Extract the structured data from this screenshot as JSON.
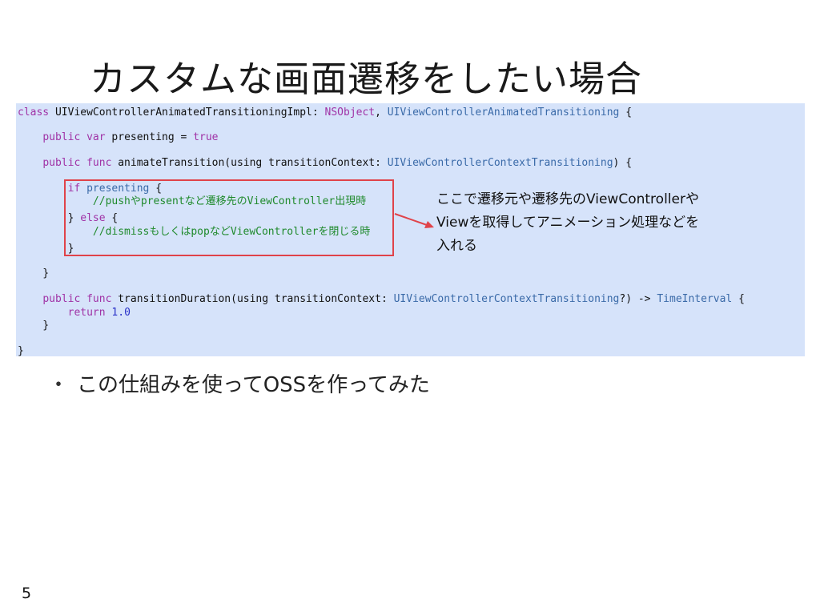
{
  "slide": {
    "title": "カスタムな画面遷移をしたい場合",
    "page_number": "5"
  },
  "code": {
    "line1": [
      {
        "t": "class",
        "c": "kw"
      },
      {
        "t": " UIViewControllerAnimatedTransitioningImpl: ",
        "c": ""
      },
      {
        "t": "NSObject",
        "c": "kw"
      },
      {
        "t": ", ",
        "c": ""
      },
      {
        "t": "UIViewControllerAnimatedTransitioning",
        "c": "ty"
      },
      {
        "t": " {",
        "c": ""
      }
    ],
    "line2": [
      {
        "t": "    ",
        "c": ""
      },
      {
        "t": "public var",
        "c": "kw"
      },
      {
        "t": " presenting = ",
        "c": ""
      },
      {
        "t": "true",
        "c": "kw"
      }
    ],
    "line3": [
      {
        "t": "    ",
        "c": ""
      },
      {
        "t": "public func",
        "c": "kw"
      },
      {
        "t": " animateTransition(using transitionContext: ",
        "c": ""
      },
      {
        "t": "UIViewControllerContextTransitioning",
        "c": "ty"
      },
      {
        "t": ") {",
        "c": ""
      }
    ],
    "line4": [
      {
        "t": "        ",
        "c": ""
      },
      {
        "t": "if",
        "c": "kw"
      },
      {
        "t": " ",
        "c": ""
      },
      {
        "t": "presenting",
        "c": "ty"
      },
      {
        "t": " {",
        "c": ""
      }
    ],
    "line5": [
      {
        "t": "            //pushやpresentなど遷移先のViewController出現時",
        "c": "cm"
      }
    ],
    "line6": [
      {
        "t": "        } ",
        "c": ""
      },
      {
        "t": "else",
        "c": "kw"
      },
      {
        "t": " {",
        "c": ""
      }
    ],
    "line7": [
      {
        "t": "            //dismissもしくはpopなどViewControllerを閉じる時",
        "c": "cm"
      }
    ],
    "line8": [
      {
        "t": "        }",
        "c": ""
      }
    ],
    "line9": [
      {
        "t": "    }",
        "c": ""
      }
    ],
    "line10": [
      {
        "t": "    ",
        "c": ""
      },
      {
        "t": "public func",
        "c": "kw"
      },
      {
        "t": " transitionDuration(using transitionContext: ",
        "c": ""
      },
      {
        "t": "UIViewControllerContextTransitioning",
        "c": "ty"
      },
      {
        "t": "?) -> ",
        "c": ""
      },
      {
        "t": "TimeInterval",
        "c": "ty"
      },
      {
        "t": " {",
        "c": ""
      }
    ],
    "line11": [
      {
        "t": "        ",
        "c": ""
      },
      {
        "t": "return",
        "c": "kw"
      },
      {
        "t": " ",
        "c": ""
      },
      {
        "t": "1.0",
        "c": "num"
      }
    ],
    "line12": [
      {
        "t": "    }",
        "c": ""
      }
    ],
    "line13": [
      {
        "t": "}",
        "c": ""
      }
    ]
  },
  "callout": {
    "line1": "ここで遷移元や遷移先のViewControllerや",
    "line2": "Viewを取得してアニメーション処理などを",
    "line3": "入れる"
  },
  "bullet": {
    "marker": "・",
    "text": "この仕組みを使ってOSSを作ってみた"
  },
  "colors": {
    "panel_background": "#d6e3fa",
    "keyword": "#a033a6",
    "type": "#3a6aa8",
    "comment": "#1f8a2c",
    "number": "#2a32c8",
    "highlight_border": "#e0434a"
  }
}
